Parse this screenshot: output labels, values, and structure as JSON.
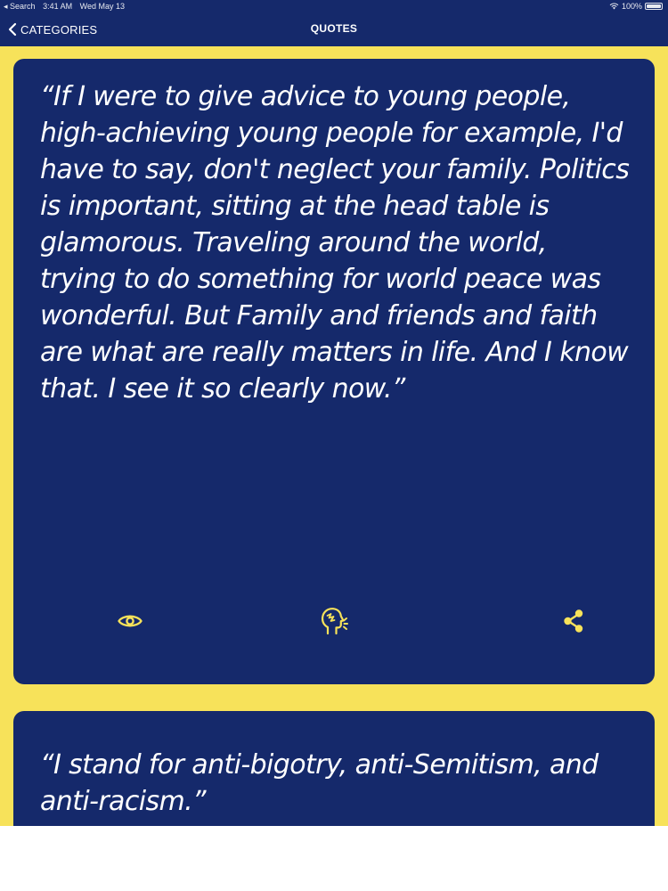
{
  "status_bar": {
    "back_app": "◂ Search",
    "time": "3:41 AM",
    "date": "Wed May 13",
    "battery": "100%",
    "icons": [
      "wifi-icon",
      "battery-icon"
    ]
  },
  "nav": {
    "back_label": "CATEGORIES",
    "title": "QUOTES",
    "icons": [
      "chevron-left-icon"
    ]
  },
  "quotes": [
    {
      "text": "“If I were to give advice to young people, high-achieving young people for example, I'd have to say, don't neglect your family. Politics is important, sitting at the head table is glamorous. Traveling around the world, trying to do something for world peace was wonderful. But Family and friends and faith are what are really matters in life. And I know that. I see it so clearly now.”",
      "actions": [
        "eye-icon",
        "speak-icon",
        "share-icon"
      ]
    },
    {
      "text": "“I stand for anti-bigotry, anti-Semitism, and anti-racism.”"
    }
  ],
  "colors": {
    "background": "#f7e25a",
    "card": "#15296b",
    "accent": "#f7e25a",
    "text": "#ffffff"
  }
}
